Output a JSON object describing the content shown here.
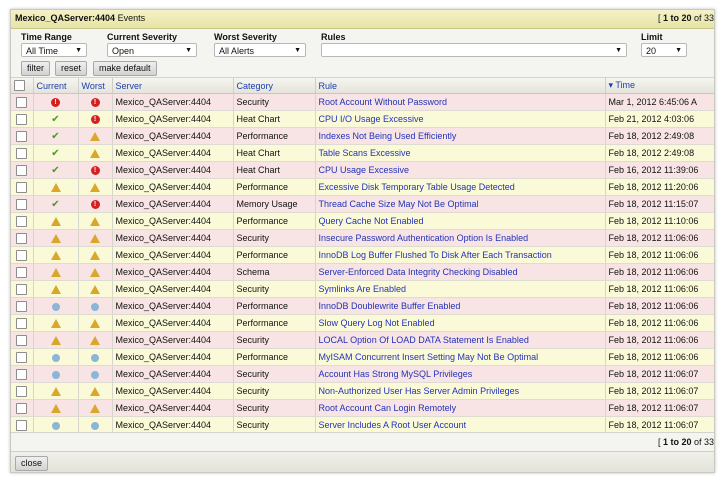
{
  "window": {
    "title": "Mexico_QAServer:4404",
    "title_suffix": " Events",
    "paging_prefix": "[ ",
    "paging_range": "1 to 20",
    "paging_suffix": " of 33"
  },
  "filters": {
    "time_range": {
      "label": "Time Range",
      "value": "All Time"
    },
    "current_severity": {
      "label": "Current Severity",
      "value": "Open"
    },
    "worst_severity": {
      "label": "Worst Severity",
      "value": "All Alerts"
    },
    "rules": {
      "label": "Rules",
      "value": ""
    },
    "limit": {
      "label": "Limit",
      "value": "20"
    }
  },
  "buttons": {
    "filter": "filter",
    "reset": "reset",
    "make_default": "make default",
    "close": "close"
  },
  "columns": {
    "current": "Current",
    "worst": "Worst",
    "server": "Server",
    "category": "Category",
    "rule": "Rule",
    "time": "Time"
  },
  "rows": [
    {
      "current": "critical",
      "worst": "critical",
      "server": "Mexico_QAServer:4404",
      "category": "Security",
      "rule": "Root Account Without Password",
      "time": "Mar 1, 2012 6:45:06 A",
      "tone": "pink"
    },
    {
      "current": "ok",
      "worst": "critical",
      "server": "Mexico_QAServer:4404",
      "category": "Heat Chart",
      "rule": "CPU I/O Usage Excessive",
      "time": "Feb 21, 2012 4:03:06",
      "tone": "yellow"
    },
    {
      "current": "ok",
      "worst": "warning",
      "server": "Mexico_QAServer:4404",
      "category": "Performance",
      "rule": "Indexes Not Being Used Efficiently",
      "time": "Feb 18, 2012 2:49:08",
      "tone": "pink"
    },
    {
      "current": "ok",
      "worst": "warning",
      "server": "Mexico_QAServer:4404",
      "category": "Heat Chart",
      "rule": "Table Scans Excessive",
      "time": "Feb 18, 2012 2:49:08",
      "tone": "yellow"
    },
    {
      "current": "ok",
      "worst": "critical",
      "server": "Mexico_QAServer:4404",
      "category": "Heat Chart",
      "rule": "CPU Usage Excessive",
      "time": "Feb 16, 2012 11:39:06",
      "tone": "pink"
    },
    {
      "current": "warning",
      "worst": "warning",
      "server": "Mexico_QAServer:4404",
      "category": "Performance",
      "rule": "Excessive Disk Temporary Table Usage Detected",
      "time": "Feb 18, 2012 11:20:06",
      "tone": "yellow"
    },
    {
      "current": "ok",
      "worst": "critical",
      "server": "Mexico_QAServer:4404",
      "category": "Memory Usage",
      "rule": "Thread Cache Size May Not Be Optimal",
      "time": "Feb 18, 2012 11:15:07",
      "tone": "pink"
    },
    {
      "current": "warning",
      "worst": "warning",
      "server": "Mexico_QAServer:4404",
      "category": "Performance",
      "rule": "Query Cache Not Enabled",
      "time": "Feb 18, 2012 11:10:06",
      "tone": "yellow"
    },
    {
      "current": "warning",
      "worst": "warning",
      "server": "Mexico_QAServer:4404",
      "category": "Security",
      "rule": "Insecure Password Authentication Option Is Enabled",
      "time": "Feb 18, 2012 11:06:06",
      "tone": "pink"
    },
    {
      "current": "warning",
      "worst": "warning",
      "server": "Mexico_QAServer:4404",
      "category": "Performance",
      "rule": "InnoDB Log Buffer Flushed To Disk After Each Transaction",
      "time": "Feb 18, 2012 11:06:06",
      "tone": "yellow"
    },
    {
      "current": "warning",
      "worst": "warning",
      "server": "Mexico_QAServer:4404",
      "category": "Schema",
      "rule": "Server-Enforced Data Integrity Checking Disabled",
      "time": "Feb 18, 2012 11:06:06",
      "tone": "pink"
    },
    {
      "current": "warning",
      "worst": "warning",
      "server": "Mexico_QAServer:4404",
      "category": "Security",
      "rule": "Symlinks Are Enabled",
      "time": "Feb 18, 2012 11:06:06",
      "tone": "yellow"
    },
    {
      "current": "info",
      "worst": "info",
      "server": "Mexico_QAServer:4404",
      "category": "Performance",
      "rule": "InnoDB Doublewrite Buffer Enabled",
      "time": "Feb 18, 2012 11:06:06",
      "tone": "pink"
    },
    {
      "current": "warning",
      "worst": "warning",
      "server": "Mexico_QAServer:4404",
      "category": "Performance",
      "rule": "Slow Query Log Not Enabled",
      "time": "Feb 18, 2012 11:06:06",
      "tone": "yellow"
    },
    {
      "current": "warning",
      "worst": "warning",
      "server": "Mexico_QAServer:4404",
      "category": "Security",
      "rule": "LOCAL Option Of LOAD DATA Statement Is Enabled",
      "time": "Feb 18, 2012 11:06:06",
      "tone": "pink"
    },
    {
      "current": "info",
      "worst": "info",
      "server": "Mexico_QAServer:4404",
      "category": "Performance",
      "rule": "MyISAM Concurrent Insert Setting May Not Be Optimal",
      "time": "Feb 18, 2012 11:06:06",
      "tone": "yellow"
    },
    {
      "current": "info",
      "worst": "info",
      "server": "Mexico_QAServer:4404",
      "category": "Security",
      "rule": "Account Has Strong MySQL Privileges",
      "time": "Feb 18, 2012 11:06:07",
      "tone": "pink"
    },
    {
      "current": "warning",
      "worst": "warning",
      "server": "Mexico_QAServer:4404",
      "category": "Security",
      "rule": "Non-Authorized User Has Server Admin Privileges",
      "time": "Feb 18, 2012 11:06:07",
      "tone": "yellow"
    },
    {
      "current": "warning",
      "worst": "warning",
      "server": "Mexico_QAServer:4404",
      "category": "Security",
      "rule": "Root Account Can Login Remotely",
      "time": "Feb 18, 2012 11:06:07",
      "tone": "pink"
    },
    {
      "current": "info",
      "worst": "info",
      "server": "Mexico_QAServer:4404",
      "category": "Security",
      "rule": "Server Includes A Root User Account",
      "time": "Feb 18, 2012 11:06:07",
      "tone": "yellow"
    }
  ]
}
